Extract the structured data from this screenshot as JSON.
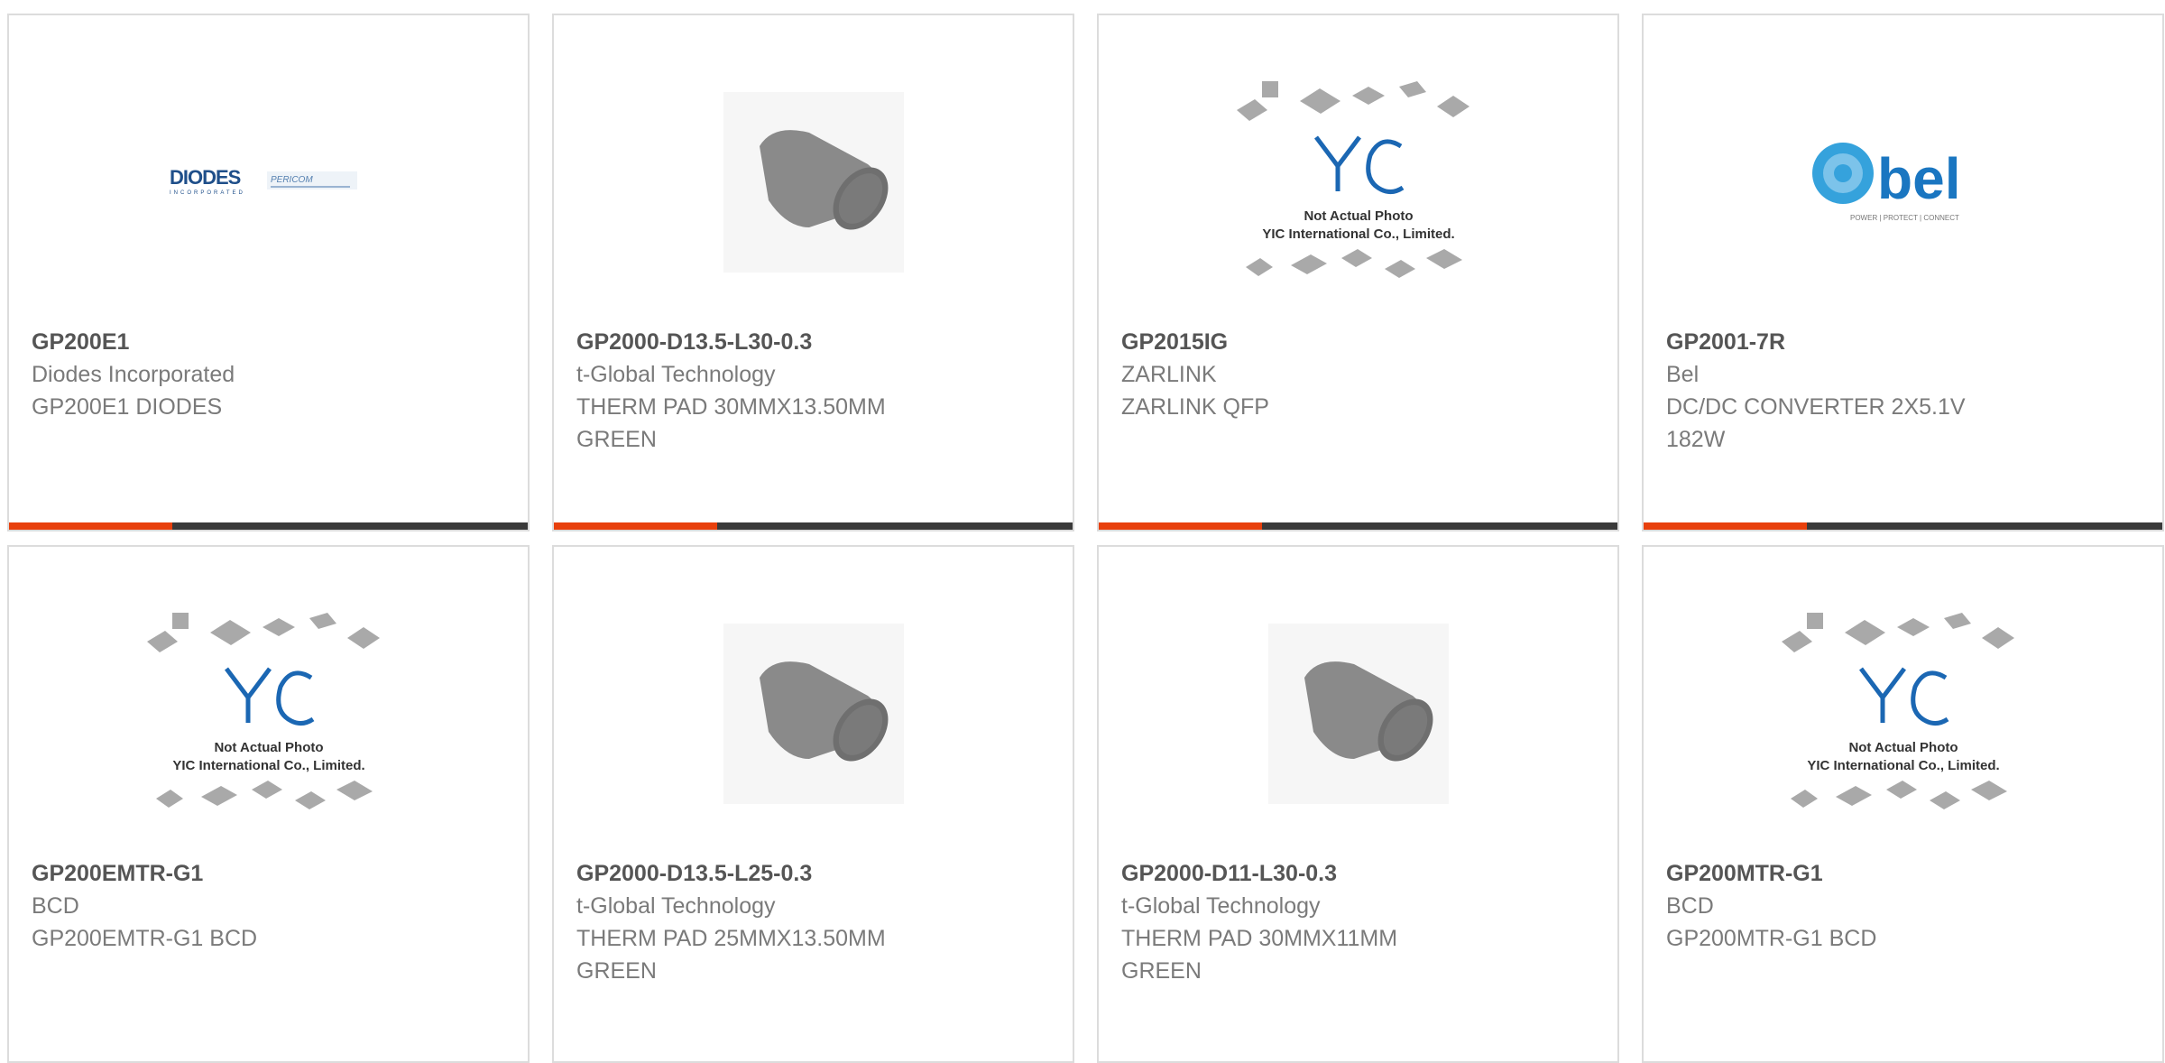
{
  "colors": {
    "accent": "#e8400c",
    "bar": "#3a3a3a",
    "border": "#dcdcdc",
    "part": "#555555",
    "text": "#7a7a7a"
  },
  "products": [
    {
      "part": "GP200E1",
      "manufacturer": "Diodes Incorporated",
      "description": "GP200E1 DIODES",
      "image": "diodes-logo",
      "logo_text": "DIODES",
      "logo_subtext": "INCORPORATED",
      "logo_partner": "PERICOM"
    },
    {
      "part": "GP2000-D13.5-L30-0.3",
      "manufacturer": "t-Global Technology",
      "description": "THERM PAD 30MMX13.50MM\nGREEN",
      "image": "therm-pad-photo"
    },
    {
      "part": "GP2015IG",
      "manufacturer": "ZARLINK",
      "description": "ZARLINK QFP",
      "image": "yic-placeholder",
      "placeholder_line1": "Not Actual Photo",
      "placeholder_line2": "YIC International Co., Limited."
    },
    {
      "part": "GP2001-7R",
      "manufacturer": "Bel",
      "description": "DC/DC CONVERTER 2X5.1V\n182W",
      "image": "bel-logo",
      "logo_text": "bel",
      "logo_tagline": "POWER | PROTECT | CONNECT"
    },
    {
      "part": "GP200EMTR-G1",
      "manufacturer": "BCD",
      "description": "GP200EMTR-G1 BCD",
      "image": "yic-placeholder",
      "placeholder_line1": "Not Actual Photo",
      "placeholder_line2": "YIC International Co., Limited."
    },
    {
      "part": "GP2000-D13.5-L25-0.3",
      "manufacturer": "t-Global Technology",
      "description": "THERM PAD 25MMX13.50MM\nGREEN",
      "image": "therm-pad-photo"
    },
    {
      "part": "GP2000-D11-L30-0.3",
      "manufacturer": "t-Global Technology",
      "description": "THERM PAD 30MMX11MM\nGREEN",
      "image": "therm-pad-photo"
    },
    {
      "part": "GP200MTR-G1",
      "manufacturer": "BCD",
      "description": "GP200MTR-G1 BCD",
      "image": "yic-placeholder",
      "placeholder_line1": "Not Actual Photo",
      "placeholder_line2": "YIC International Co., Limited."
    }
  ]
}
